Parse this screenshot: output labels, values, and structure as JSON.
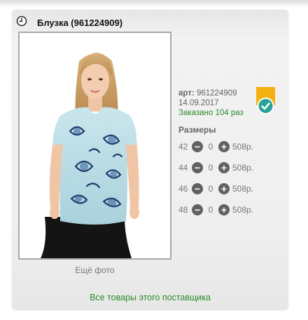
{
  "product": {
    "title": "Блузка (961224909)",
    "article_label": "арт:",
    "article_value": "961224909",
    "date": "14.09.2017",
    "ordered": "Заказано 104 раз"
  },
  "gallery": {
    "more_photos": "Ещё фото"
  },
  "sizes": {
    "title": "Размеры",
    "rows": [
      {
        "size": "42",
        "qty": "0",
        "price": "508р."
      },
      {
        "size": "44",
        "qty": "0",
        "price": "508р."
      },
      {
        "size": "46",
        "qty": "0",
        "price": "508р."
      },
      {
        "size": "48",
        "qty": "0",
        "price": "508р."
      }
    ]
  },
  "footer": {
    "supplier_link": "Все товары этого поставщика"
  },
  "icons": {
    "clock": "clock-icon",
    "badge": "checkmark-badge-icon",
    "minus": "minus-circle-icon",
    "plus": "plus-circle-icon"
  },
  "colors": {
    "accent_green": "#2a8a2a",
    "badge_orange": "#f2b10f",
    "badge_teal": "#2aa198"
  }
}
